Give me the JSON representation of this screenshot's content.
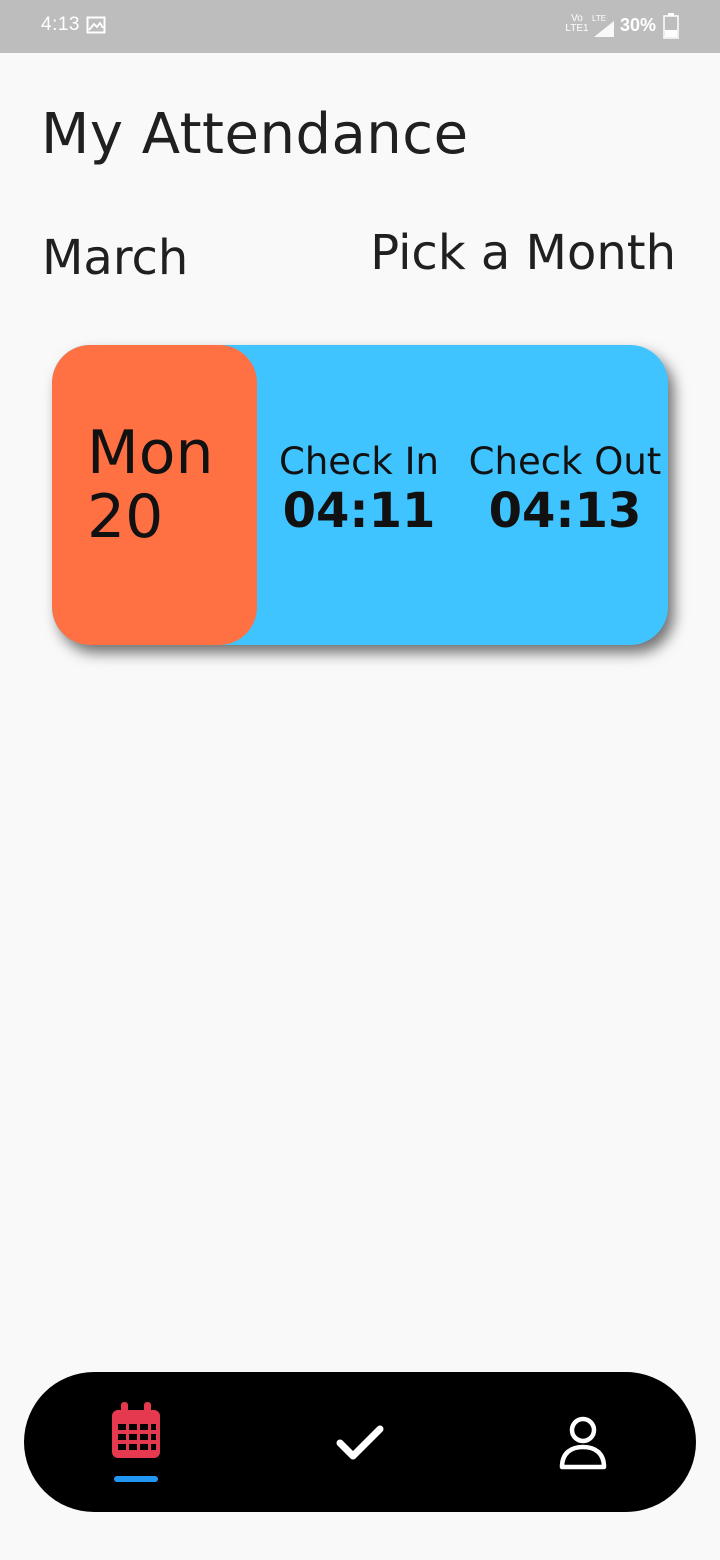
{
  "status_bar": {
    "time": "4:13",
    "volte_top": "Vo",
    "volte_bottom": "LTE1",
    "network": "LTE",
    "battery": "30%"
  },
  "header": {
    "title": "My Attendance"
  },
  "month_row": {
    "month": "March",
    "pick_label": "Pick a Month"
  },
  "records": [
    {
      "day": "Mon",
      "date": "20",
      "check_in_label": "Check In",
      "check_in_time": "04:11",
      "check_out_label": "Check Out",
      "check_out_time": "04:13"
    }
  ],
  "colors": {
    "card": "#40c4ff",
    "date_block": "#ff7043",
    "nav_bg": "#000000",
    "nav_active_icon": "#e53950",
    "nav_indicator": "#2196f3"
  },
  "bottom_nav": {
    "items": [
      {
        "icon": "calendar-icon",
        "active": true
      },
      {
        "icon": "check-icon",
        "active": false
      },
      {
        "icon": "person-icon",
        "active": false
      }
    ]
  }
}
